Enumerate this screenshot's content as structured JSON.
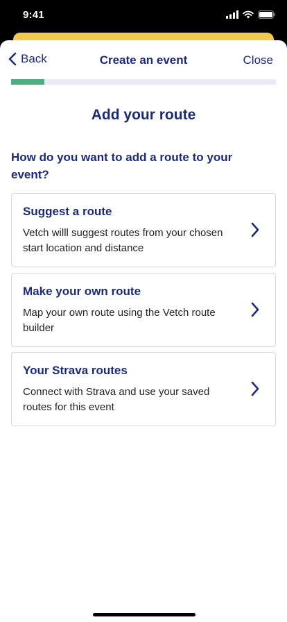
{
  "status_bar": {
    "time": "9:41"
  },
  "nav": {
    "back_label": "Back",
    "title": "Create an event",
    "close_label": "Close"
  },
  "progress": {
    "fraction": 0.125
  },
  "page": {
    "heading": "Add your route",
    "question": "How do you want to add a route to your event?"
  },
  "options": [
    {
      "title": "Suggest a route",
      "description": "Vetch willl suggest routes from your chosen start location and distance"
    },
    {
      "title": "Make your own route",
      "description": "Map your own route using the Vetch route builder"
    },
    {
      "title": "Your Strava routes",
      "description": "Connect with Strava and use your saved routes for this event"
    }
  ],
  "colors": {
    "accent": "#1b2a78",
    "progress": "#4caf82",
    "underlay_sheet": "#f2c94c"
  },
  "icons": {
    "back": "chevron-left-icon",
    "option_arrow": "chevron-right-icon"
  }
}
